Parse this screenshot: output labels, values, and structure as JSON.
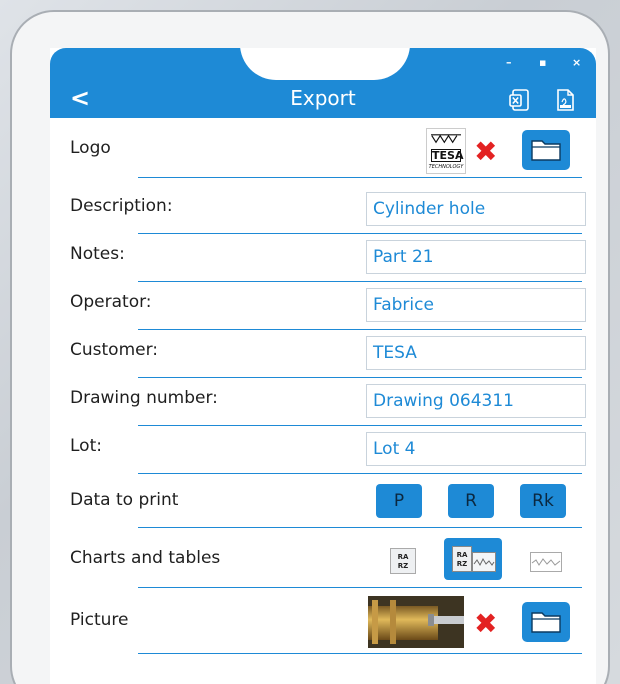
{
  "window": {
    "title": "Export",
    "back_label": "<"
  },
  "logo": {
    "label": "Logo",
    "brand_text": "TESA",
    "brand_sub": "TECHNOLOGY"
  },
  "fields": [
    {
      "label": "Description:",
      "value": "Cylinder hole"
    },
    {
      "label": "Notes:",
      "value": "Part 21"
    },
    {
      "label": "Operator:",
      "value": "Fabrice"
    },
    {
      "label": "Customer:",
      "value": "TESA"
    },
    {
      "label": "Drawing number:",
      "value": "Drawing 064311"
    },
    {
      "label": "Lot:",
      "value": "Lot 4"
    }
  ],
  "data_to_print": {
    "label": "Data to print",
    "buttons": [
      "P",
      "R",
      "Rk"
    ]
  },
  "charts": {
    "label": "Charts and tables",
    "ra": "RA",
    "rz": "RZ"
  },
  "picture": {
    "label": "Picture"
  },
  "colors": {
    "accent": "#1e8ad6",
    "delete": "#e32222"
  }
}
